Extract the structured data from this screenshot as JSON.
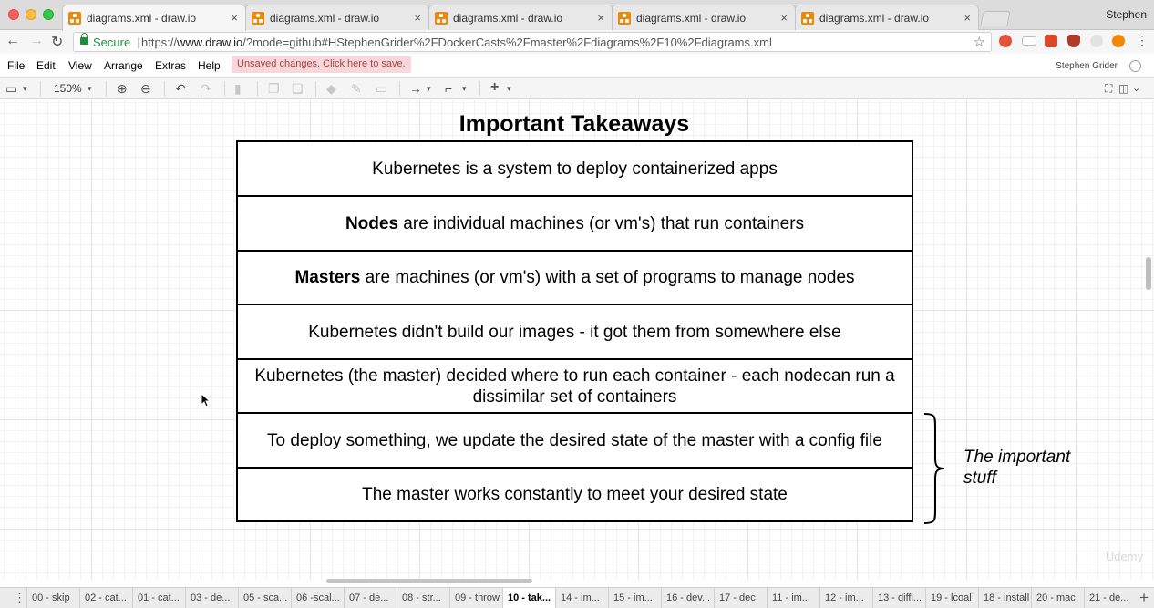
{
  "browser": {
    "tabs": [
      {
        "title": "diagrams.xml - draw.io",
        "active": true
      },
      {
        "title": "diagrams.xml - draw.io",
        "active": false
      },
      {
        "title": "diagrams.xml - draw.io",
        "active": false
      },
      {
        "title": "diagrams.xml - draw.io",
        "active": false
      },
      {
        "title": "diagrams.xml - draw.io",
        "active": false
      }
    ],
    "tab_close_glyph": "×",
    "profile": "Stephen",
    "secure_label": "Secure",
    "url_scheme": "https://",
    "url_host": "www.draw.io",
    "url_path": "/?mode=github#HStephenGrider%2FDockerCasts%2Fmaster%2Fdiagrams%2F10%2Fdiagrams.xml"
  },
  "menubar": {
    "items": [
      "File",
      "Edit",
      "View",
      "Arrange",
      "Extras",
      "Help"
    ],
    "unsaved_notice": "Unsaved changes. Click here to save.",
    "user_name": "Stephen Grider"
  },
  "toolbar": {
    "zoom": "150%"
  },
  "diagram": {
    "title": "Important Takeaways",
    "rows": [
      {
        "bold": "",
        "text": "Kubernetes is a system to deploy containerized apps"
      },
      {
        "bold": "Nodes",
        "text": " are individual machines (or vm's) that run containers"
      },
      {
        "bold": "Masters",
        "text": " are machines (or vm's) with a set of programs to manage nodes"
      },
      {
        "bold": "",
        "text": "Kubernetes didn't build our images - it got them from somewhere else"
      },
      {
        "bold": "",
        "text": "Kubernetes (the master) decided where to run each container - each nodecan run a dissimilar set of containers"
      },
      {
        "bold": "",
        "text": "To deploy something, we update the desired state of the master with a config file"
      },
      {
        "bold": "",
        "text": "The master works constantly to meet your desired state"
      }
    ],
    "side_note": "The important stuff",
    "watermark": "Udemy"
  },
  "pages": {
    "tabs": [
      "00 - skip",
      "02 - cat...",
      "01 - cat...",
      "03 - de...",
      "05 - sca...",
      "06 -scal...",
      "07 - de...",
      "08 - str...",
      "09 - throw",
      "10 - tak...",
      "14 - im...",
      "15 - im...",
      "16 - dev...",
      "17 - dec",
      "11 - im...",
      "12 - im...",
      "13 - diffi...",
      "19 - lcoal",
      "18 - install",
      "20 - mac",
      "21 - de..."
    ],
    "active_index": 9
  },
  "colors": {
    "drawio_orange": "#f08705",
    "secure_green": "#1e8e3e",
    "unsaved_bg": "#f8d7da",
    "unsaved_text": "#a94442"
  }
}
